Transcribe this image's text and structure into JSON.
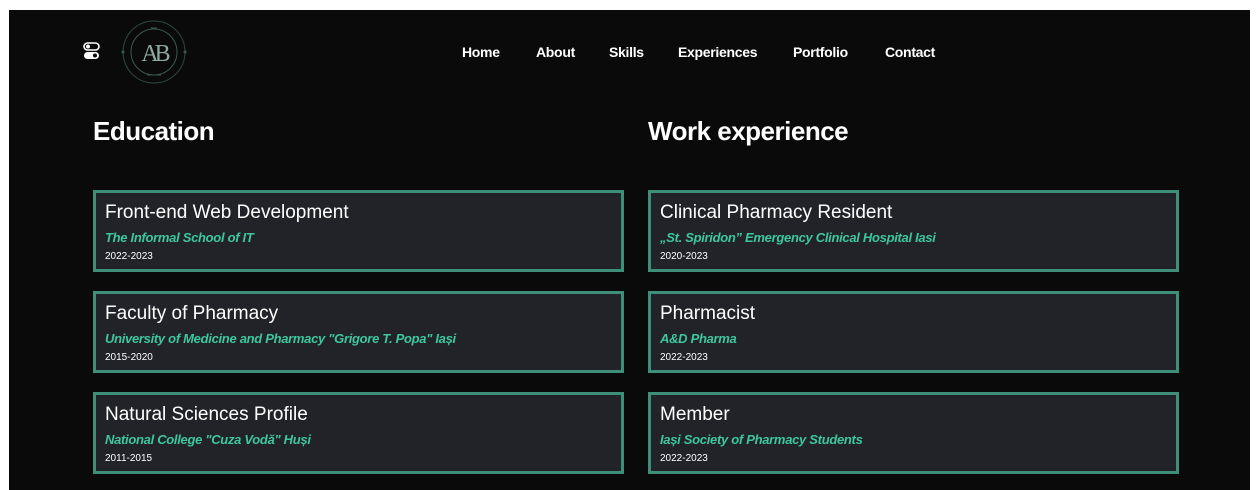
{
  "header": {
    "nav": [
      {
        "label": "Home"
      },
      {
        "label": "About"
      },
      {
        "label": "Skills"
      },
      {
        "label": "Experiences"
      },
      {
        "label": "Portfolio"
      },
      {
        "label": "Contact"
      }
    ],
    "logo_text": "AB",
    "toggle_icon": "theme-toggle-icon"
  },
  "education": {
    "title": "Education",
    "items": [
      {
        "title": "Front-end Web Development",
        "org": "The Informal School of IT",
        "dates": "2022-2023"
      },
      {
        "title": "Faculty of Pharmacy",
        "org": "University of Medicine and Pharmacy \"Grigore T. Popa\" Iași",
        "dates": "2015-2020"
      },
      {
        "title": "Natural Sciences Profile",
        "org": "National College \"Cuza Vodă\" Huși",
        "dates": "2011-2015"
      }
    ]
  },
  "work": {
    "title": "Work experience",
    "items": [
      {
        "title": "Clinical Pharmacy Resident",
        "org": "„St. Spiridon” Emergency Clinical Hospital Iasi",
        "dates": "2020-2023"
      },
      {
        "title": "Pharmacist",
        "org": "A&D Pharma",
        "dates": "2022-2023"
      },
      {
        "title": "Member",
        "org": "Iași Society of Pharmacy Students",
        "dates": "2022-2023"
      }
    ]
  },
  "colors": {
    "background": "#0a0a0b",
    "card": "#212329",
    "card_border": "#3e8f78",
    "accent": "#3ec79c"
  }
}
